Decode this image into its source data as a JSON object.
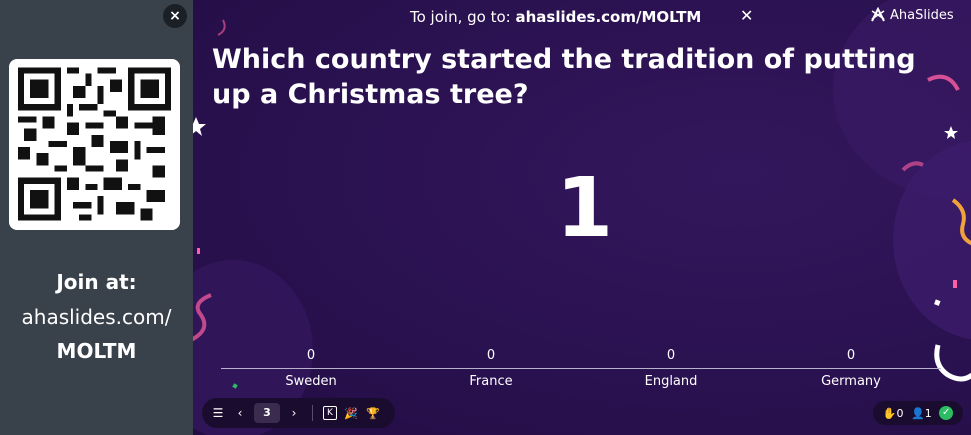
{
  "side_panel": {
    "close_icon": "×",
    "join_label": "Join at:",
    "join_url": "ahaslides.com/",
    "join_code": "MOLTM"
  },
  "banner": {
    "prefix": "To join, go to: ",
    "url": "ahaslides.com/MOLTM",
    "close_icon": "✕"
  },
  "brand": {
    "name": "AhaSlides"
  },
  "question": "Which country started the tradition of putting up a Christmas tree?",
  "counter": "1",
  "chart_data": {
    "type": "bar",
    "categories": [
      "Sweden",
      "France",
      "England",
      "Germany"
    ],
    "values": [
      0,
      0,
      0,
      0
    ]
  },
  "toolbar": {
    "menu_icon": "☰",
    "prev_icon": "‹",
    "page": "3",
    "next_icon": "›",
    "k_icon": "K",
    "confetti_icon": "🎉",
    "trophy_icon": "🏆"
  },
  "status": {
    "hands": "0",
    "participants": "1",
    "ok_icon": "✓"
  },
  "colors": {
    "stage_bg": "#2b1250",
    "side_bg": "#39414a",
    "accent_pink": "#ff5fa2",
    "status_green": "#2bbd63"
  }
}
